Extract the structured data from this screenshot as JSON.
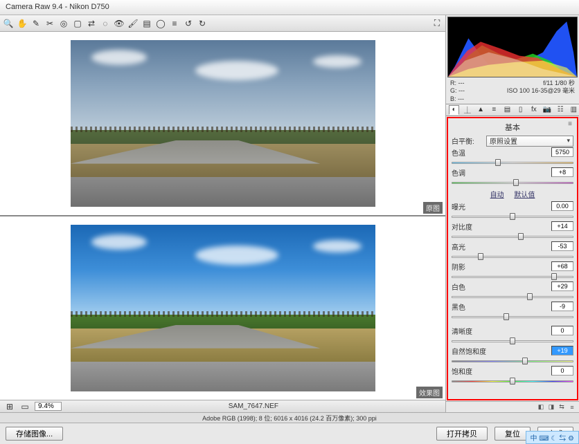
{
  "window_title": "Camera Raw 9.4  -  Nikon D750",
  "preview": {
    "original_label": "原图",
    "result_label": "效果图",
    "zoom": "9.4%",
    "filename": "SAM_7647.NEF"
  },
  "info": {
    "r": "R:  ---",
    "g": "G:  ---",
    "b": "B:  ---",
    "aperture_shutter": "f/11  1/80 秒",
    "iso_lens": "ISO 100  16-35@29 毫米"
  },
  "panel": {
    "title": "基本",
    "wb_label": "白平衡:",
    "wb_value": "原照设置",
    "temp_label": "色温",
    "temp_value": "5750",
    "tint_label": "色调",
    "tint_value": "+8",
    "auto_label": "自动",
    "default_label": "默认值",
    "exposure_label": "曝光",
    "exposure_value": "0.00",
    "contrast_label": "对比度",
    "contrast_value": "+14",
    "highlights_label": "高光",
    "highlights_value": "-53",
    "shadows_label": "阴影",
    "shadows_value": "+68",
    "whites_label": "白色",
    "whites_value": "+29",
    "blacks_label": "黑色",
    "blacks_value": "-9",
    "clarity_label": "清晰度",
    "clarity_value": "0",
    "vibrance_label": "自然饱和度",
    "vibrance_value": "+19",
    "saturation_label": "饱和度",
    "saturation_value": "0"
  },
  "bottombar": "Adobe RGB (1998); 8 位; 6016 x 4016 (24.2 百万像素); 300 ppi",
  "buttons": {
    "save": "存储图像...",
    "open": "打开拷贝",
    "reset": "复位",
    "done": "完成"
  },
  "ime_strip": "中 ⌨ ☾ ⇆ ⚙"
}
